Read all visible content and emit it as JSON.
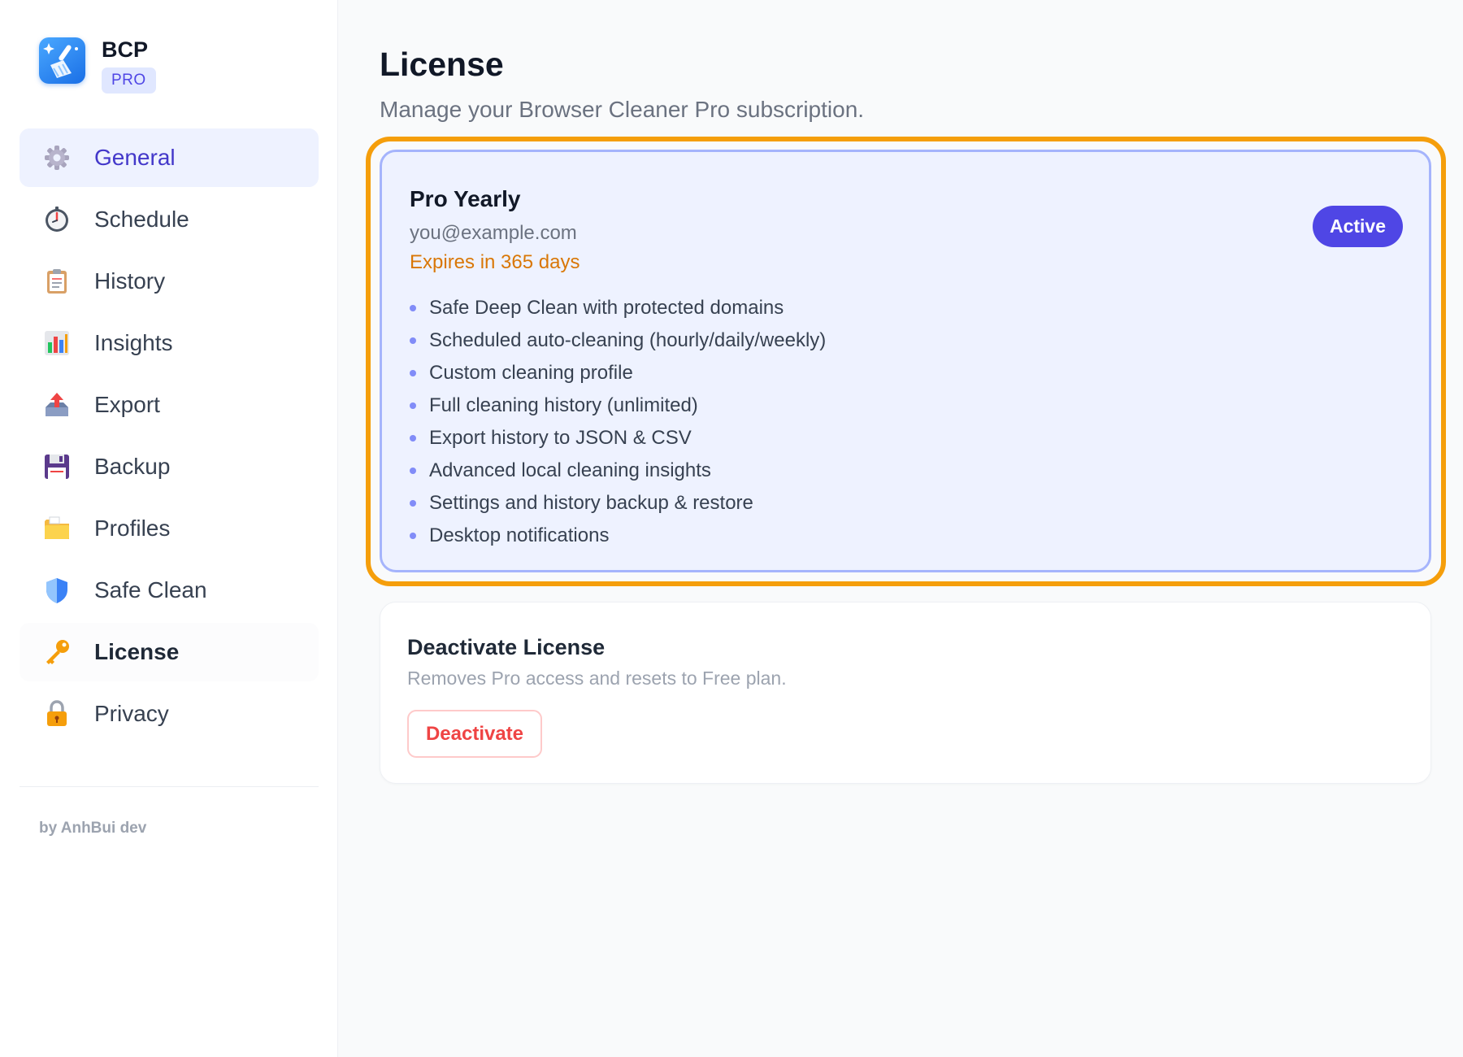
{
  "brand": {
    "name": "BCP",
    "badge": "PRO"
  },
  "sidebar": {
    "items": [
      {
        "label": "General",
        "icon": "gear-icon"
      },
      {
        "label": "Schedule",
        "icon": "stopwatch-icon"
      },
      {
        "label": "History",
        "icon": "clipboard-icon"
      },
      {
        "label": "Insights",
        "icon": "bar-chart-icon"
      },
      {
        "label": "Export",
        "icon": "outbox-tray-icon"
      },
      {
        "label": "Backup",
        "icon": "floppy-disk-icon"
      },
      {
        "label": "Profiles",
        "icon": "folder-icon"
      },
      {
        "label": "Safe Clean",
        "icon": "shield-icon"
      },
      {
        "label": "License",
        "icon": "key-icon"
      },
      {
        "label": "Privacy",
        "icon": "lock-icon"
      }
    ],
    "footer": "by AnhBui dev"
  },
  "page": {
    "title": "License",
    "subtitle": "Manage your Browser Cleaner Pro subscription."
  },
  "plan": {
    "name": "Pro Yearly",
    "email": "you@example.com",
    "expiry": "Expires in 365 days",
    "status": "Active",
    "features": [
      "Safe Deep Clean with protected domains",
      "Scheduled auto-cleaning (hourly/daily/weekly)",
      "Custom cleaning profile",
      "Full cleaning history (unlimited)",
      "Export history to JSON & CSV",
      "Advanced local cleaning insights",
      "Settings and history backup & restore",
      "Desktop notifications"
    ]
  },
  "deactivate": {
    "title": "Deactivate License",
    "description": "Removes Pro access and resets to Free plan.",
    "button_label": "Deactivate"
  },
  "colors": {
    "accent": "#4f46e5",
    "highlight": "#f59e0b",
    "warning": "#d97706",
    "danger": "#ef4444"
  }
}
